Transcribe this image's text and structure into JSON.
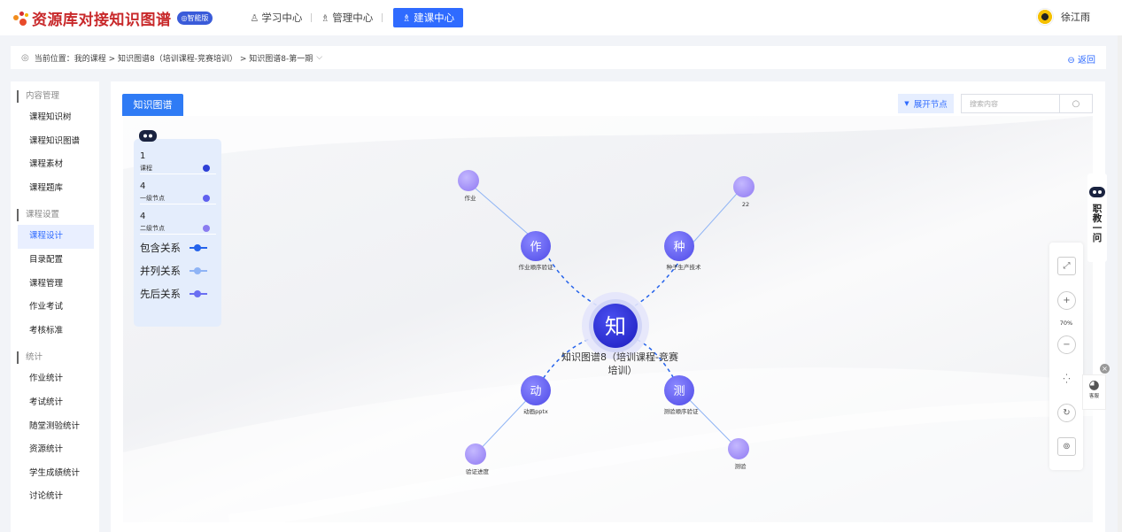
{
  "header": {
    "title": "资源库对接知识图谱",
    "badge": "◎智能版",
    "nav": [
      {
        "label": "学习中心",
        "icon": "person-icon"
      },
      {
        "label": "管理中心",
        "icon": "people-icon"
      },
      {
        "label": "建课中心",
        "icon": "people-icon",
        "active": true
      }
    ],
    "user_name": "徐江雨"
  },
  "breadcrumb": {
    "prefix": "当前位置：",
    "path": "我的课程 > 知识图谱8（培训课程-竞赛培训） > 知识图谱8-第一期",
    "back": "返回"
  },
  "sidebar": {
    "groups": [
      {
        "title": "内容管理",
        "items": [
          "课程知识树",
          "课程知识图谱",
          "课程素材",
          "课程题库"
        ]
      },
      {
        "title": "课程设置",
        "items": [
          "课程设计",
          "目录配置",
          "课程管理",
          "作业考试",
          "考核标准"
        ]
      },
      {
        "title": "统计",
        "items": [
          "作业统计",
          "考试统计",
          "随堂测验统计",
          "资源统计",
          "学生成绩统计",
          "讨论统计"
        ]
      }
    ],
    "active_item": "课程设计"
  },
  "main": {
    "tab": "知识图谱",
    "expand_button": "展开节点",
    "search_placeholder": "搜索内容"
  },
  "legend": {
    "counts": [
      {
        "num": "1",
        "label": "课程",
        "color": "#2d3fd6"
      },
      {
        "num": "4",
        "label": "一级节点",
        "color": "#5f60ef"
      },
      {
        "num": "4",
        "label": "二级节点",
        "color": "#8a7cf0"
      }
    ],
    "relations": [
      {
        "label": "包含关系",
        "color": "#2563eb"
      },
      {
        "label": "并列关系",
        "color": "#8fb4f5"
      },
      {
        "label": "先后关系",
        "color": "#6a6ff2"
      }
    ]
  },
  "graph": {
    "center": {
      "char": "知",
      "label_line1": "知识图谱8（培训课程-竞赛",
      "label_line2": "培训）"
    },
    "first_level": [
      {
        "char": "作",
        "label": "作业顺序验证"
      },
      {
        "char": "种",
        "label": "种子生产技术"
      },
      {
        "char": "动",
        "label": "动画pptx"
      },
      {
        "char": "测",
        "label": "测验顺序验证"
      }
    ],
    "second_level": [
      "作业",
      "22",
      "验证进度",
      "测验"
    ]
  },
  "tools": {
    "zoom": "70%"
  },
  "assistant": {
    "text": [
      "职",
      "教",
      "一",
      "问"
    ],
    "sub": "客服"
  },
  "colors": {
    "accent": "#2f6bff",
    "brand_red": "#c8282a"
  }
}
